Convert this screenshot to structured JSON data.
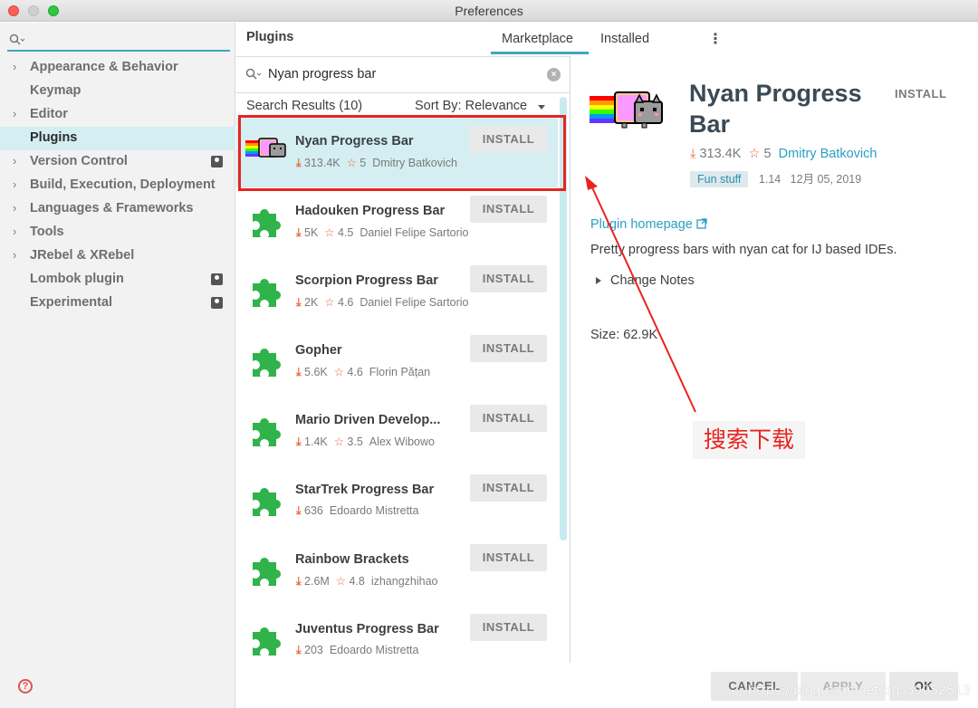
{
  "window": {
    "title": "Preferences"
  },
  "sidebar": {
    "search_placeholder": "",
    "items": [
      {
        "label": "Appearance & Behavior",
        "expandable": true
      },
      {
        "label": "Keymap",
        "expandable": false
      },
      {
        "label": "Editor",
        "expandable": true
      },
      {
        "label": "Plugins",
        "expandable": false,
        "selected": true
      },
      {
        "label": "Version Control",
        "expandable": true,
        "badge": true
      },
      {
        "label": "Build, Execution, Deployment",
        "expandable": true
      },
      {
        "label": "Languages & Frameworks",
        "expandable": true
      },
      {
        "label": "Tools",
        "expandable": true
      },
      {
        "label": "JRebel & XRebel",
        "expandable": true
      },
      {
        "label": "Lombok plugin",
        "expandable": false,
        "badge": true
      },
      {
        "label": "Experimental",
        "expandable": false,
        "badge": true
      }
    ],
    "help_label": "?"
  },
  "header": {
    "title": "Plugins",
    "tabs": [
      "Marketplace",
      "Installed"
    ],
    "active_tab": "Marketplace",
    "menu_glyph": "⋮"
  },
  "search": {
    "query": "Nyan progress bar",
    "clear_glyph": "×"
  },
  "results": {
    "count_label": "Search Results (10)",
    "sort_label": "Sort By: Relevance"
  },
  "plugins": [
    {
      "name": "Nyan Progress Bar",
      "downloads": "313.4K",
      "rating": "5",
      "author": "Dmitry Batkovich",
      "install_label": "INSTALL",
      "icon": "nyan-cat-icon",
      "selected": true
    },
    {
      "name": "Hadouken Progress Bar",
      "downloads": "5K",
      "rating": "4.5",
      "author": "Daniel Felipe Sartorio",
      "install_label": "INSTALL",
      "icon": "puzzle-piece-icon"
    },
    {
      "name": "Scorpion Progress Bar",
      "downloads": "2K",
      "rating": "4.6",
      "author": "Daniel Felipe Sartorio",
      "install_label": "INSTALL",
      "icon": "puzzle-piece-icon"
    },
    {
      "name": "Gopher",
      "downloads": "5.6K",
      "rating": "4.6",
      "author": "Florin Pățan",
      "install_label": "INSTALL",
      "icon": "puzzle-piece-icon"
    },
    {
      "name": "Mario Driven Develop...",
      "downloads": "1.4K",
      "rating": "3.5",
      "author": "Alex Wibowo",
      "install_label": "INSTALL",
      "icon": "puzzle-piece-icon"
    },
    {
      "name": "StarTrek Progress Bar",
      "downloads": "636",
      "rating": "",
      "author": "Edoardo Mistretta",
      "install_label": "INSTALL",
      "icon": "puzzle-piece-icon"
    },
    {
      "name": "Rainbow Brackets",
      "downloads": "2.6M",
      "rating": "4.8",
      "author": "izhangzhihao",
      "install_label": "INSTALL",
      "icon": "puzzle-piece-icon"
    },
    {
      "name": "Juventus Progress Bar",
      "downloads": "203",
      "rating": "",
      "author": "Edoardo Mistretta",
      "install_label": "INSTALL",
      "icon": "puzzle-piece-icon"
    }
  ],
  "detail": {
    "name": "Nyan Progress Bar",
    "install_label": "INSTALL",
    "downloads": "313.4K",
    "rating": "5",
    "vendor": "Dmitry Batkovich",
    "tag": "Fun stuff",
    "version": "1.14",
    "date": "12月 05, 2019",
    "homepage_label": "Plugin homepage",
    "description": "Pretty progress bars with nyan cat for IJ based IDEs.",
    "change_notes_label": "Change Notes",
    "size_label": "Size: 62.9K"
  },
  "annotation": {
    "text": "搜索下载",
    "color": "#e8241f"
  },
  "footer": {
    "cancel_label": "CANCEL",
    "apply_label": "APPLY",
    "ok_label": "OK"
  },
  "watermark": "https://blog.csdn.net/qq_39052513",
  "colors": {
    "accent": "#40a6bd",
    "selection": "#d5eef2",
    "plugin_icon": "#2fb34a",
    "rating": "#e86b3a",
    "link": "#2a9ec4"
  }
}
